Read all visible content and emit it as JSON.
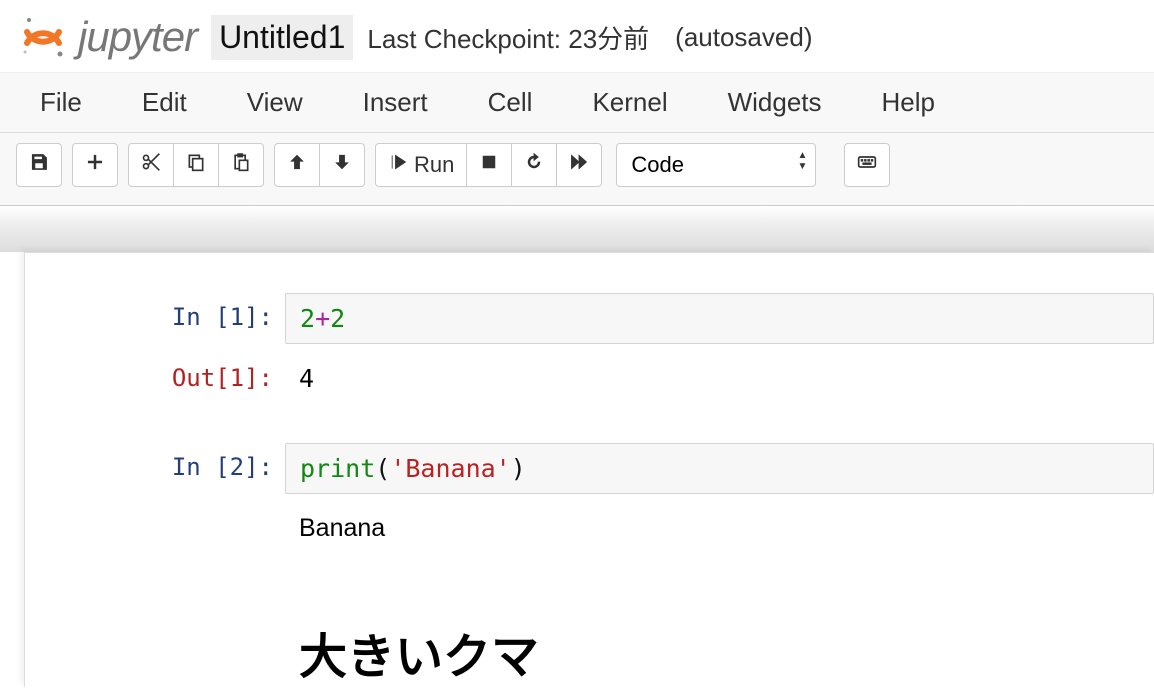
{
  "header": {
    "brand": "jupyter",
    "title": "Untitled1",
    "checkpoint_label": "Last Checkpoint: 23分前",
    "autosaved_label": "(autosaved)"
  },
  "menu": {
    "file": "File",
    "edit": "Edit",
    "view": "View",
    "insert": "Insert",
    "cell": "Cell",
    "kernel": "Kernel",
    "widgets": "Widgets",
    "help": "Help"
  },
  "toolbar": {
    "run_label": "Run",
    "celltype_selected": "Code"
  },
  "cells": {
    "c1": {
      "in_prompt": "In [1]:",
      "num1": "2",
      "op": "+",
      "num2": "2",
      "out_prompt": "Out[1]:",
      "out_value": "4"
    },
    "c2": {
      "in_prompt": "In [2]:",
      "fn": "print",
      "lparen": "(",
      "str": "'Banana'",
      "rparen": ")",
      "stdout": "Banana"
    },
    "c3": {
      "in_prompt": "",
      "heading": "大きいクマ"
    }
  }
}
